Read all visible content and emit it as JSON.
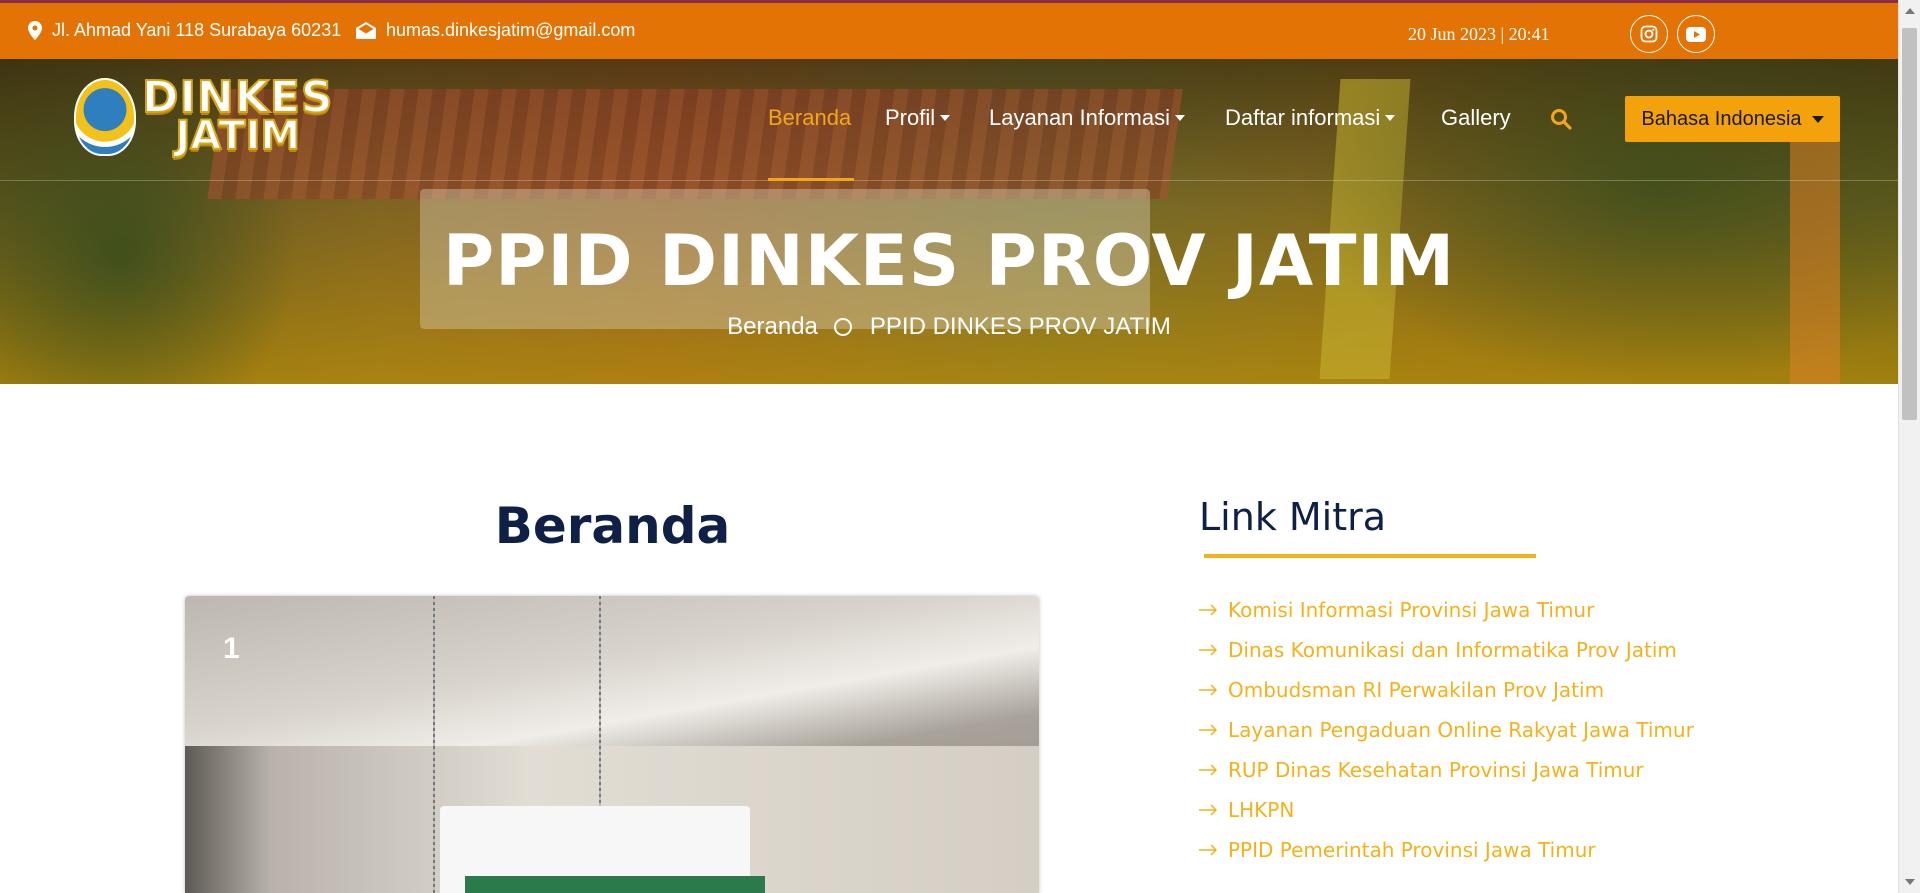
{
  "topbar": {
    "address": "Jl. Ahmad Yani 118 Surabaya 60231",
    "email": "humas.dinkesjatim@gmail.com",
    "datetime": "20 Jun 2023 | 20:41",
    "icons": [
      "location-pin-icon",
      "envelope-icon",
      "instagram-icon",
      "youtube-icon"
    ]
  },
  "logo": {
    "line1": "DINKES",
    "line2": "JATIM"
  },
  "nav": {
    "items": [
      {
        "label": "Beranda",
        "active": true,
        "dropdown": false
      },
      {
        "label": "Profil",
        "active": false,
        "dropdown": true
      },
      {
        "label": "Layanan Informasi",
        "active": false,
        "dropdown": true
      },
      {
        "label": "Daftar informasi",
        "active": false,
        "dropdown": true
      },
      {
        "label": "Gallery",
        "active": false,
        "dropdown": false
      }
    ],
    "language": "Bahasa Indonesia",
    "active_color": "#f3a61c"
  },
  "hero": {
    "title": "PPID DINKES PROV JATIM",
    "breadcrumb": [
      "Beranda",
      "PPID DINKES PROV JATIM"
    ]
  },
  "main": {
    "title": "Beranda",
    "slide_number": "1"
  },
  "sidebar": {
    "title": "Link Mitra",
    "links": [
      "Komisi Informasi Provinsi Jawa Timur",
      "Dinas Komunikasi dan Informatika Prov Jatim",
      "Ombudsman RI Perwakilan Prov Jatim",
      "Layanan Pengaduan Online Rakyat Jawa Timur",
      "RUP Dinas Kesehatan Provinsi Jawa Timur",
      "LHKPN",
      "PPID Pemerintah Provinsi Jawa Timur"
    ]
  },
  "colors": {
    "topbar": "#e37305",
    "accent": "#f3b21c",
    "heading": "#0e2046"
  }
}
